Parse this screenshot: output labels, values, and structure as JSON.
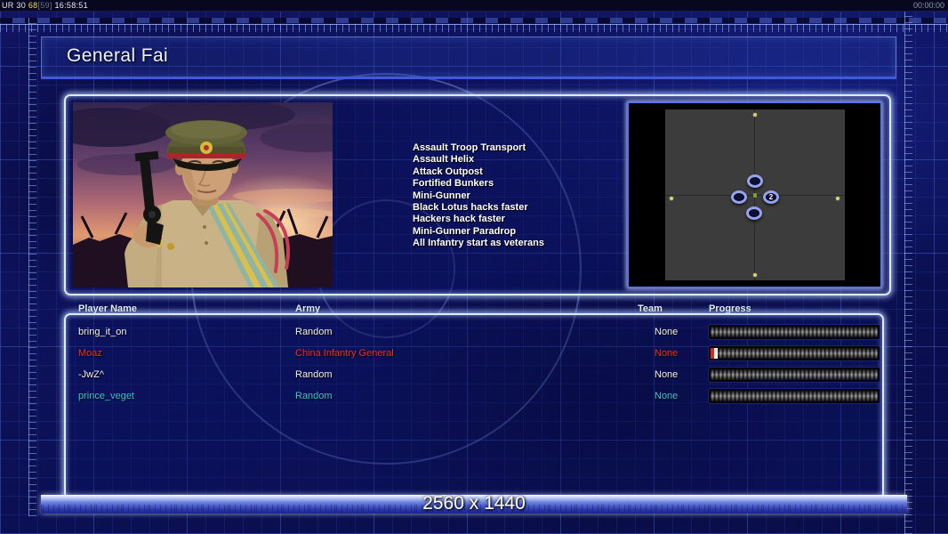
{
  "status_bar": {
    "left": {
      "app": "UR 30",
      "fps": "68",
      "bracket": "[59]",
      "clock": "16:58:51"
    },
    "right_timer": "00:00:00"
  },
  "header": {
    "title": "General Fai"
  },
  "general_panel": {
    "abilities": [
      "Assault Troop Transport",
      "Assault Helix",
      "Attack Outpost",
      "Fortified Bunkers",
      "Mini-Gunner",
      "Black Lotus hacks faster",
      "Hackers hack faster",
      "Mini-Gunner Paradrop",
      "All Infantry start as veterans"
    ]
  },
  "minimap": {
    "start_marker_label": "2"
  },
  "players_table": {
    "columns": {
      "name": "Player Name",
      "army": "Army",
      "team": "Team",
      "progress": "Progress"
    },
    "rows": [
      {
        "name": "bring_it_on",
        "army": "Random",
        "team": "None",
        "color": "#f2f2f2",
        "progress_percent": 0
      },
      {
        "name": "Moaz",
        "army": "China Infantry General",
        "team": "None",
        "color": "#ff291c",
        "progress_percent": 4
      },
      {
        "name": "-JwZ^",
        "army": "Random",
        "team": "None",
        "color": "#f2f2f2",
        "progress_percent": 0
      },
      {
        "name": "prince_veget",
        "army": "Random",
        "team": "None",
        "color": "#38c8dc",
        "progress_percent": 0
      }
    ]
  },
  "footer": {
    "resolution_label": "2560 x 1440"
  },
  "colors": {
    "accent_blue": "#3f5ad8",
    "panel_border": "#dfe9ff",
    "red_player": "#ff291c",
    "cyan_player": "#38c8dc",
    "marker_yellow": "#d8d868"
  }
}
